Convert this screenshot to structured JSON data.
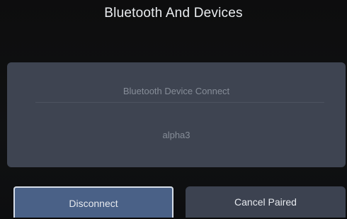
{
  "header": {
    "title": "Bluetooth And Devices"
  },
  "panel": {
    "heading": "Bluetooth Device Connect",
    "device_name": "alpha3"
  },
  "actions": {
    "disconnect_label": "Disconnect",
    "cancel_paired_label": "Cancel Paired"
  },
  "colors": {
    "background": "#0d0d0e",
    "panel": "#3e4451",
    "selected_button": "#4a6187",
    "button": "#3c4250"
  }
}
